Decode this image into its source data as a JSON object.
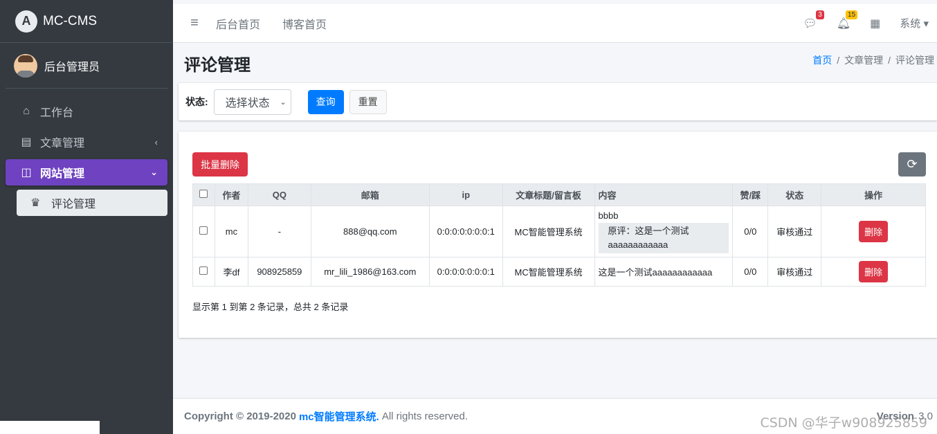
{
  "brand": {
    "name": "MC-CMS",
    "logo": "A"
  },
  "user": {
    "name": "后台管理员"
  },
  "sidebar": {
    "items": [
      {
        "label": "工作台",
        "icon": "home-icon"
      },
      {
        "label": "文章管理",
        "icon": "list-icon",
        "arrow": "‹"
      },
      {
        "label": "网站管理",
        "icon": "window-icon",
        "arrow": "⌄"
      }
    ],
    "sub": {
      "label": "评论管理",
      "icon": "crown-icon"
    }
  },
  "topbar": {
    "menu_icon": "≡",
    "links": [
      "后台首页",
      "博客首页"
    ],
    "messages_count": "3",
    "notifications_count": "15",
    "system_label": "系统"
  },
  "header": {
    "title": "评论管理",
    "breadcrumb": [
      "首页",
      "文章管理",
      "评论管理"
    ]
  },
  "filter": {
    "status_label": "状态:",
    "status_value": "选择状态",
    "query_label": "查询",
    "reset_label": "重置"
  },
  "table": {
    "bulk_delete_label": "批量删除",
    "columns": [
      "作者",
      "QQ",
      "邮箱",
      "ip",
      "文章标题/留言板",
      "内容",
      "赞/踩",
      "状态",
      "操作"
    ],
    "rows": [
      {
        "author": "mc",
        "qq": "-",
        "email": "888@qq.com",
        "ip": "0:0:0:0:0:0:0:1",
        "article": "MC智能管理系统",
        "content": "bbbb",
        "quote": "原评：这是一个测试aaaaaaaaaaaa",
        "votes": "0/0",
        "status": "审核通过",
        "action": "删除"
      },
      {
        "author": "李df",
        "qq": "908925859",
        "email": "mr_lili_1986@163.com",
        "ip": "0:0:0:0:0:0:0:1",
        "article": "MC智能管理系统",
        "content": "这是一个测试aaaaaaaaaaaa",
        "votes": "0/0",
        "status": "审核通过",
        "action": "删除"
      }
    ],
    "info": "显示第 1 到第 2 条记录，总共 2 条记录"
  },
  "footer": {
    "copyright": "Copyright © 2019-2020",
    "brand": "mc智能管理系统.",
    "rights": "All rights reserved.",
    "version_label": "Version",
    "version": "3.0"
  },
  "watermark": "CSDN @华子w908925859",
  "colors": {
    "sidebar": "#343a40",
    "active": "#6f42c1",
    "primary": "#007bff",
    "danger": "#dc3545"
  }
}
